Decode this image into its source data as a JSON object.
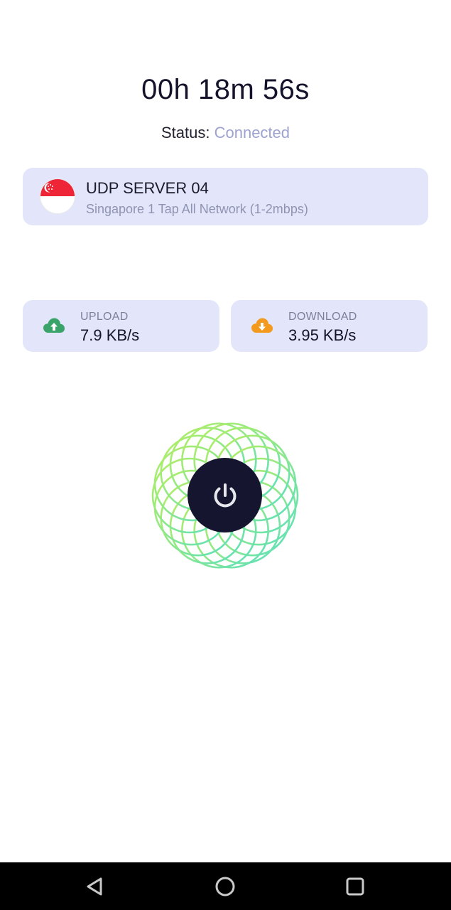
{
  "timer": "00h 18m 56s",
  "status": {
    "label": "Status:",
    "value": "Connected"
  },
  "server": {
    "name": "UDP SERVER 04",
    "description": "Singapore 1 Tap All Network (1-2mbps)",
    "flag_icon": "singapore-flag-icon"
  },
  "upload": {
    "label": "UPLOAD",
    "value": "7.9 KB/s",
    "icon": "cloud-upload-icon",
    "color": "#3aa36a"
  },
  "download": {
    "label": "DOWNLOAD",
    "value": "3.95 KB/s",
    "icon": "cloud-download-icon",
    "color": "#f39a1e"
  },
  "power": {
    "icon": "power-icon"
  },
  "navbar": {
    "back_icon": "back-triangle-icon",
    "home_icon": "home-circle-icon",
    "recent_icon": "recent-apps-square-icon"
  },
  "colors": {
    "card_bg": "#e3e6fb",
    "connected_text": "#9da2cf",
    "power_bg": "#161530",
    "ring_start": "#a6ec6c",
    "ring_end": "#5fe0b4"
  }
}
